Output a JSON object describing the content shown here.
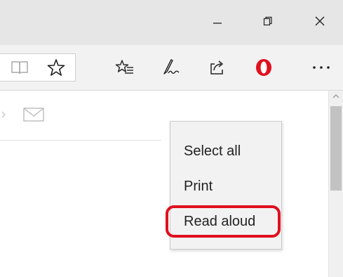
{
  "window": {
    "minimize_icon": "minimize-icon",
    "restore_icon": "restore-icon",
    "close_icon": "close-icon"
  },
  "toolbar": {
    "icons": [
      "reading-view-icon",
      "favorite-star-icon",
      "favorites-hub-icon",
      "web-note-icon",
      "share-icon",
      "opera-extension-icon",
      "more-icon"
    ],
    "accent_color": "#e0101e"
  },
  "content": {
    "mail_icon": "mail-icon"
  },
  "context_menu": {
    "items": [
      {
        "label": "Select all"
      },
      {
        "label": "Print"
      },
      {
        "label": "Read aloud"
      }
    ],
    "highlighted_item": "Read aloud",
    "highlight_color": "#e0101e"
  }
}
